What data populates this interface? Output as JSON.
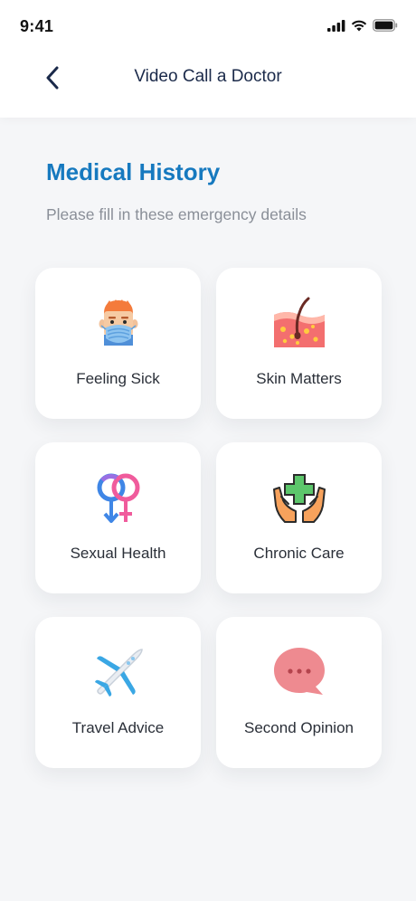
{
  "status_bar": {
    "time": "9:41"
  },
  "nav": {
    "back_icon": "chevron-left-icon",
    "title": "Video Call a Doctor"
  },
  "section": {
    "title": "Medical History",
    "subtitle": "Please fill in these emergency details"
  },
  "categories": [
    {
      "label": "Feeling Sick",
      "icon": "sick-person-mask-icon"
    },
    {
      "label": "Skin Matters",
      "icon": "skin-layer-icon"
    },
    {
      "label": "Sexual Health",
      "icon": "gender-symbols-icon"
    },
    {
      "label": "Chronic Care",
      "icon": "hands-medical-cross-icon"
    },
    {
      "label": "Travel Advice",
      "icon": "airplane-icon"
    },
    {
      "label": "Second Opinion",
      "icon": "chat-bubble-icon"
    }
  ],
  "colors": {
    "accent": "#1679bf",
    "nav_title": "#1b2a4a",
    "background": "#f5f6f8",
    "card": "#ffffff"
  }
}
